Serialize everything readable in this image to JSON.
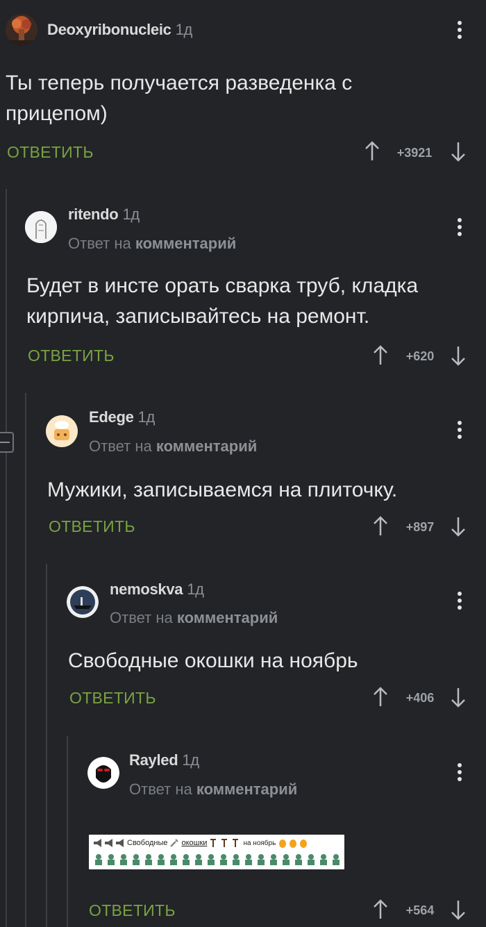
{
  "common": {
    "reply_label": "ОТВЕТИТЬ",
    "reply_prefix": "Ответ на",
    "reply_target": "комментарий"
  },
  "comments": [
    {
      "author": "Deoxyribonucleic",
      "time": "1д",
      "text": "Ты теперь получается разведенка с прицепом)",
      "rating": "+3921"
    },
    {
      "author": "ritendo",
      "time": "1д",
      "text": "Будет в инсте орать сварка труб, кладка кирпича, записывайтесь на ремонт.",
      "rating": "+620"
    },
    {
      "author": "Edege",
      "time": "1д",
      "text": "Мужики, записываемся на плиточку.",
      "rating": "+897"
    },
    {
      "author": "nemoskva",
      "time": "1д",
      "text": "Свободные окошки на ноябрь",
      "rating": "+406"
    },
    {
      "author": "Rayled",
      "time": "1д",
      "text": "",
      "rating": "+564"
    }
  ],
  "attachment": {
    "line1_words": [
      "Свободные",
      "окошки",
      "на ноябрь"
    ],
    "icons": [
      "megaphone-icon",
      "wrench-icon",
      "hammer-icon",
      "fire-icon",
      "worker-icon"
    ]
  },
  "colors": {
    "background": "#222427",
    "accent": "#7aa343",
    "text": "#e8e8e8"
  }
}
